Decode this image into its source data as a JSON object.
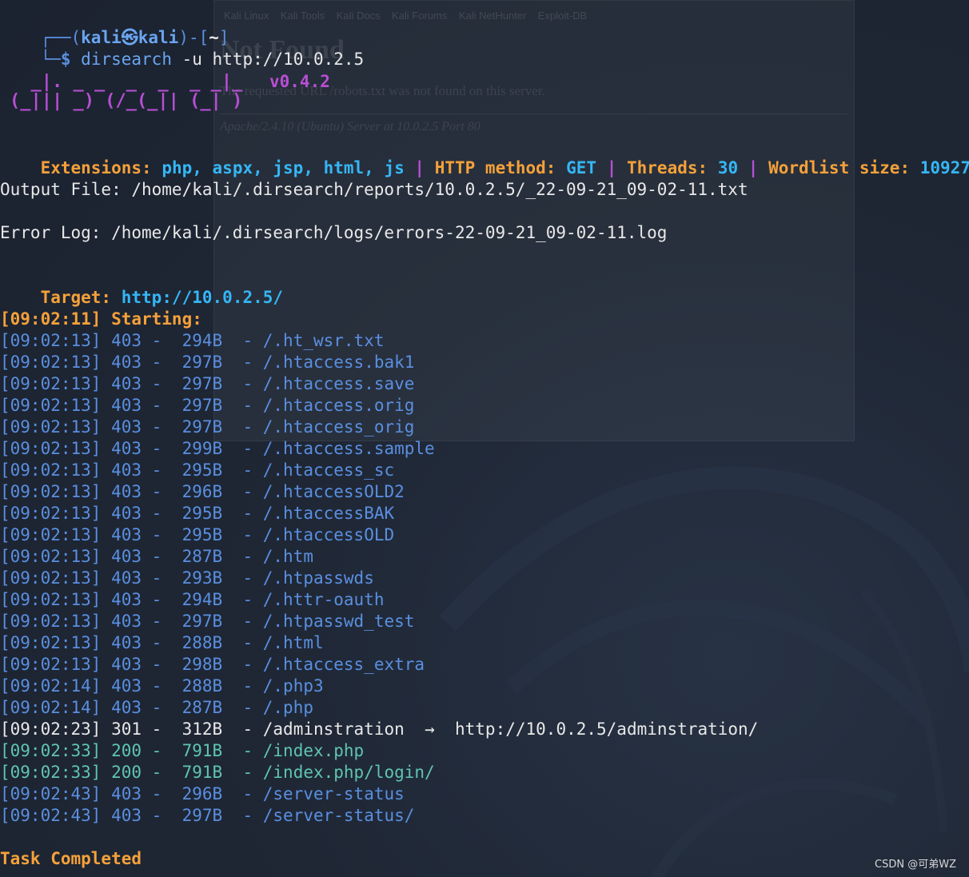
{
  "background_window": {
    "tabs": "Kali Linux    Kali Tools    Kali Docs    Kali Forums    Kali NetHunter    Exploit-DB",
    "heading": "Not Found",
    "message": "The requested URL /robots.txt was not found on this server.",
    "address": "Apache/2.4.10 (Ubuntu) Server at 10.0.2.5 Port 80"
  },
  "prompt": {
    "line1": "┌──(kali㉿kali)-[~]",
    "user": "kali㉿kali",
    "dir": "~",
    "line2_prefix": "└─$",
    "command": "dirsearch",
    "args": "-u http://10.0.2.5"
  },
  "banner": {
    "art_top": "  _|. _ _  _  _  _ _|_",
    "art_bottom": "(_||| _) (/_(_|| (_| )",
    "version": "v0.4.2"
  },
  "config": {
    "extensions_label": "Extensions:",
    "extensions_value": "php, aspx, jsp, html, js",
    "sep": "|",
    "method_label": "HTTP method:",
    "method_value": "GET",
    "threads_label": "Threads:",
    "threads_value": "30",
    "wordlist_label": "Wordlist size:",
    "wordlist_value": "10927"
  },
  "output_file": "Output File: /home/kali/.dirsearch/reports/10.0.2.5/_22-09-21_09-02-11.txt",
  "error_log": "Error Log: /home/kali/.dirsearch/logs/errors-22-09-21_09-02-11.log",
  "target": {
    "label": "Target:",
    "url": "http://10.0.2.5/"
  },
  "starting": "[09:02:11] Starting:",
  "results": [
    {
      "time": "[09:02:13]",
      "code": "403",
      "size": "294B",
      "path": "/.ht_wsr.txt"
    },
    {
      "time": "[09:02:13]",
      "code": "403",
      "size": "297B",
      "path": "/.htaccess.bak1"
    },
    {
      "time": "[09:02:13]",
      "code": "403",
      "size": "297B",
      "path": "/.htaccess.save"
    },
    {
      "time": "[09:02:13]",
      "code": "403",
      "size": "297B",
      "path": "/.htaccess.orig"
    },
    {
      "time": "[09:02:13]",
      "code": "403",
      "size": "297B",
      "path": "/.htaccess_orig"
    },
    {
      "time": "[09:02:13]",
      "code": "403",
      "size": "299B",
      "path": "/.htaccess.sample"
    },
    {
      "time": "[09:02:13]",
      "code": "403",
      "size": "295B",
      "path": "/.htaccess_sc"
    },
    {
      "time": "[09:02:13]",
      "code": "403",
      "size": "296B",
      "path": "/.htaccessOLD2"
    },
    {
      "time": "[09:02:13]",
      "code": "403",
      "size": "295B",
      "path": "/.htaccessBAK"
    },
    {
      "time": "[09:02:13]",
      "code": "403",
      "size": "295B",
      "path": "/.htaccessOLD"
    },
    {
      "time": "[09:02:13]",
      "code": "403",
      "size": "287B",
      "path": "/.htm"
    },
    {
      "time": "[09:02:13]",
      "code": "403",
      "size": "293B",
      "path": "/.htpasswds"
    },
    {
      "time": "[09:02:13]",
      "code": "403",
      "size": "294B",
      "path": "/.httr-oauth"
    },
    {
      "time": "[09:02:13]",
      "code": "403",
      "size": "297B",
      "path": "/.htpasswd_test"
    },
    {
      "time": "[09:02:13]",
      "code": "403",
      "size": "288B",
      "path": "/.html"
    },
    {
      "time": "[09:02:13]",
      "code": "403",
      "size": "298B",
      "path": "/.htaccess_extra"
    },
    {
      "time": "[09:02:14]",
      "code": "403",
      "size": "288B",
      "path": "/.php3"
    },
    {
      "time": "[09:02:14]",
      "code": "403",
      "size": "287B",
      "path": "/.php"
    },
    {
      "time": "[09:02:23]",
      "code": "301",
      "size": "312B",
      "path": "/adminstration",
      "redirect": "→  http://10.0.2.5/adminstration/"
    },
    {
      "time": "[09:02:33]",
      "code": "200",
      "size": "791B",
      "path": "/index.php"
    },
    {
      "time": "[09:02:33]",
      "code": "200",
      "size": "791B",
      "path": "/index.php/login/"
    },
    {
      "time": "[09:02:43]",
      "code": "403",
      "size": "296B",
      "path": "/server-status"
    },
    {
      "time": "[09:02:43]",
      "code": "403",
      "size": "297B",
      "path": "/server-status/"
    }
  ],
  "task_completed": "Task Completed",
  "watermark": "CSDN @可弟WZ",
  "colors": {
    "background": "#1e2634",
    "prompt_blue": "#5a8fe0",
    "cyan": "#35b6f4",
    "orange": "#f5a13a",
    "purple": "#b84fd4",
    "ok_green": "#5fc5b0"
  }
}
